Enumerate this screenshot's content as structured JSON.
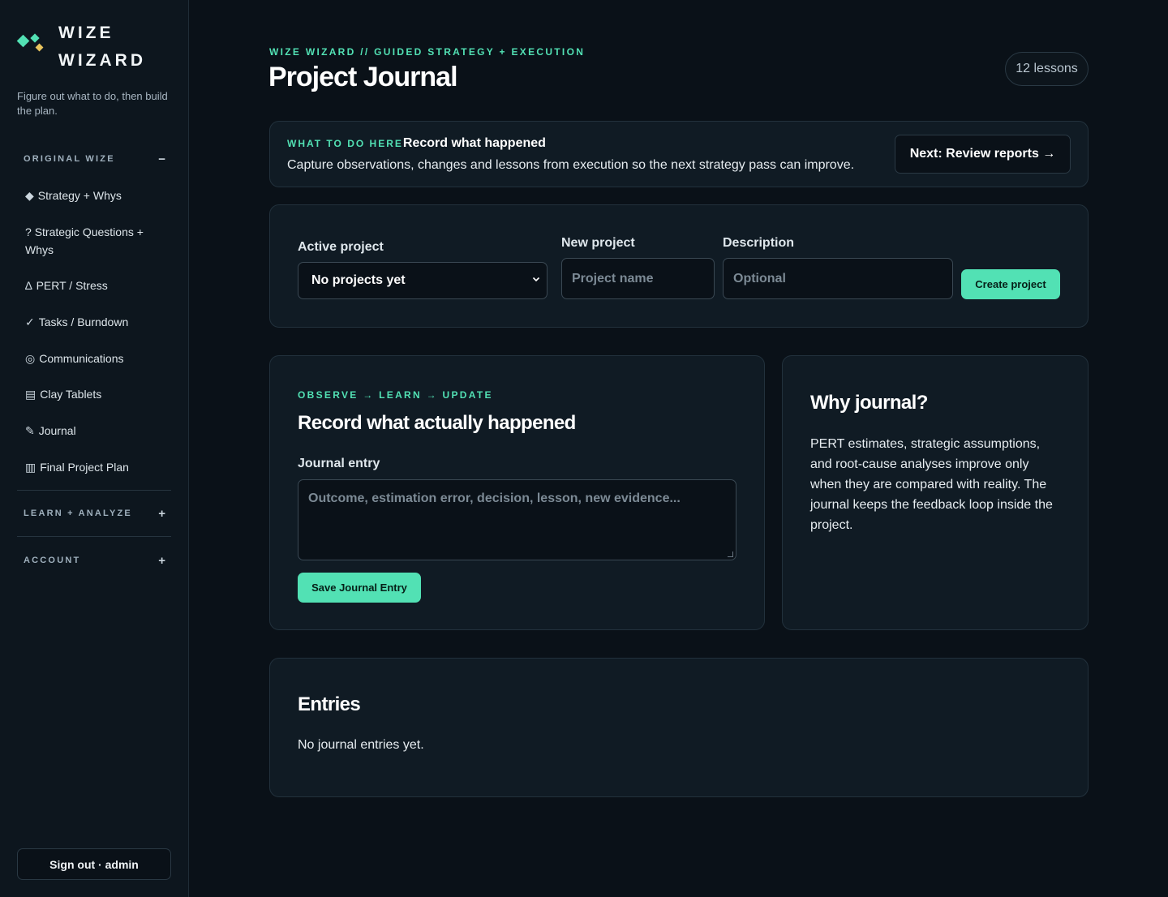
{
  "brand": {
    "line1": "WIZE",
    "line2": "WIZARD",
    "tagline": "Figure out what to do, then build the plan."
  },
  "sidebar": {
    "section_original": {
      "label": "ORIGINAL WIZE",
      "toggle": "−"
    },
    "items": [
      {
        "icon": "◆",
        "label": "Strategy + Whys"
      },
      {
        "icon": "?",
        "label": "Strategic Questions + Whys"
      },
      {
        "icon": "∆",
        "label": "PERT / Stress"
      },
      {
        "icon": "✓",
        "label": "Tasks / Burndown"
      },
      {
        "icon": "◎",
        "label": "Communications"
      },
      {
        "icon": "▤",
        "label": "Clay Tablets"
      },
      {
        "icon": "✎",
        "label": "Journal"
      },
      {
        "icon": "▥",
        "label": "Final Project Plan"
      }
    ],
    "section_learn": {
      "label": "LEARN + ANALYZE",
      "toggle": "+"
    },
    "section_account": {
      "label": "ACCOUNT",
      "toggle": "+"
    },
    "signout": "Sign out · admin"
  },
  "header": {
    "eyebrow": "WIZE WIZARD // GUIDED STRATEGY + EXECUTION",
    "title": "Project Journal",
    "lessons": "12 lessons"
  },
  "hint": {
    "label": "WHAT TO DO HERE",
    "title": "Record what happened",
    "desc": "Capture observations, changes and lessons from execution so the next strategy pass can improve.",
    "next": "Next: Review reports →"
  },
  "project_form": {
    "active_label": "Active project",
    "active_value": "No projects yet",
    "new_label": "New project",
    "new_placeholder": "Project name",
    "desc_label": "Description",
    "desc_placeholder": "Optional",
    "create": "Create project"
  },
  "journal": {
    "eyebrow": "OBSERVE → LEARN → UPDATE",
    "title": "Record what actually happened",
    "entry_label": "Journal entry",
    "entry_placeholder": "Outcome, estimation error, decision, lesson, new evidence...",
    "save": "Save Journal Entry"
  },
  "why": {
    "title": "Why journal?",
    "body": "PERT estimates, strategic assumptions, and root-cause analyses improve only when they are compared with reality. The journal keeps the feedback loop inside the project."
  },
  "entries": {
    "title": "Entries",
    "empty": "No journal entries yet."
  },
  "colors": {
    "accent": "#52e1b4",
    "gold": "#e9c45e",
    "bg": "#0a1118",
    "card": "#101b24"
  }
}
